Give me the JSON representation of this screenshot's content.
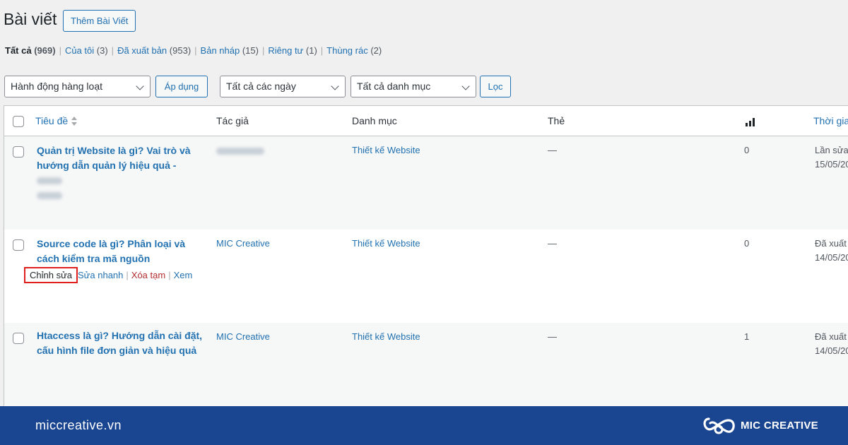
{
  "header": {
    "title": "Bài viết",
    "add_new": "Thêm Bài Viết"
  },
  "filters_nav": [
    {
      "label": "Tất cả",
      "count": "(969)",
      "current": true
    },
    {
      "label": "Của tôi",
      "count": "(3)"
    },
    {
      "label": "Đã xuất bản",
      "count": "(953)"
    },
    {
      "label": "Bản nháp",
      "count": "(15)"
    },
    {
      "label": "Riêng tư",
      "count": "(1)"
    },
    {
      "label": "Thùng rác",
      "count": "(2)"
    }
  ],
  "toolbar": {
    "bulk_action": "Hành động hàng loạt",
    "apply": "Áp dụng",
    "dates": "Tất cả các ngày",
    "categories": "Tất cả danh mục",
    "filter": "Lọc"
  },
  "columns": {
    "title": "Tiêu đề",
    "author": "Tác giả",
    "category": "Danh mục",
    "tags": "Thẻ",
    "date": "Thời gian"
  },
  "rows": [
    {
      "title_line1": "Quản trị Website là gì? Vai trò và",
      "title_line2": "hướng dẫn quản lý hiệu quả -",
      "author": "",
      "category": "Thiết kế Website",
      "tags": "—",
      "comments": "0",
      "date_line1": "Lần sửa",
      "date_line2": "15/05/20"
    },
    {
      "title_line1": "Source code là gì? Phân loại và",
      "title_line2": "cách kiểm tra mã nguồn",
      "author": "MIC Creative",
      "category": "Thiết kế Website",
      "tags": "—",
      "comments": "0",
      "date_line1": "Đã xuất",
      "date_line2": "14/05/20",
      "actions": {
        "edit": "Chỉnh sửa",
        "quick_edit": "Sửa nhanh",
        "trash": "Xóa tạm",
        "view": "Xem"
      }
    },
    {
      "title_line1": "Htaccess là gì? Hướng dẫn cài đặt,",
      "title_line2": "cấu hình file đơn giản và hiệu quả",
      "author": "MIC Creative",
      "category": "Thiết kế Website",
      "tags": "—",
      "comments": "1",
      "date_line1": "Đã xuất",
      "date_line2": "14/05/20"
    }
  ],
  "footer": {
    "site": "miccreative.vn",
    "brand": "MIC CREATIVE"
  },
  "colors": {
    "accent": "#2271b1",
    "footer_bg": "#1a4590",
    "highlight": "#e0201e",
    "trash": "#b32d2e"
  }
}
